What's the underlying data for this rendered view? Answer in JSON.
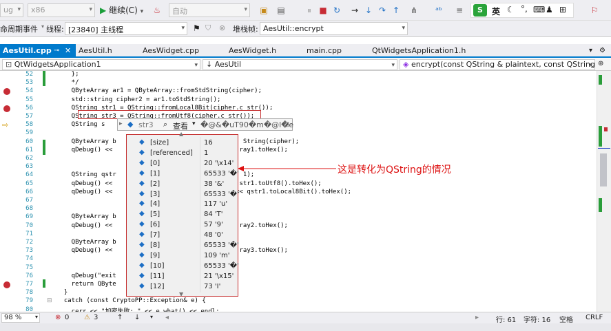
{
  "toolbar": {
    "config_partial": "ug",
    "platform": "x86",
    "continue_label": "继续(C)",
    "auto_label": "自动",
    "ime_letter": "S",
    "ime_lang": "英"
  },
  "toolbar2": {
    "lifecycle_label": "命周期事件",
    "thread_label": "线程:",
    "thread_value": "[23840] 主线程",
    "stack_label": "堆栈帧:",
    "stack_value": "AesUtil::encrypt"
  },
  "tabs": [
    {
      "label": "AesUtil.cpp"
    },
    {
      "label": "AesUtil.h"
    },
    {
      "label": "AesWidget.cpp"
    },
    {
      "label": "AesWidget.h"
    },
    {
      "label": "main.cpp"
    },
    {
      "label": "QtWidgetsApplication1.h"
    }
  ],
  "nav": {
    "project": "QtWidgetsApplication1",
    "scope": "↓ AesUtil",
    "member": "encrypt(const QString & plaintext, const QString"
  },
  "lines": [
    {
      "n": "52",
      "t": "    };"
    },
    {
      "n": "53",
      "t": "    */"
    },
    {
      "n": "54",
      "t": "    QByteArray ar1 = QByteArray::fromStdString(cipher);"
    },
    {
      "n": "55",
      "t": "    std::string cipher2 = ar1.toStdString();"
    },
    {
      "n": "56",
      "t": "    QString str1 = QString::fromLocal8Bit(cipher.c_str());"
    },
    {
      "n": "57",
      "t": "    QString str3 = QString::fromUtf8(cipher.c_str());"
    },
    {
      "n": "58",
      "t": "    QString s"
    },
    {
      "n": "59",
      "t": ""
    },
    {
      "n": "60",
      "t": "    QByteArray b                                  String(cipher);"
    },
    {
      "n": "61",
      "t": "    qDebug() <<                                  ray1.toHex();"
    },
    {
      "n": "62",
      "t": ""
    },
    {
      "n": "63",
      "t": ""
    },
    {
      "n": "64",
      "t": "    QString qstr                                  1);"
    },
    {
      "n": "65",
      "t": "    qDebug() <<                                  str1.toUtf8().toHex();"
    },
    {
      "n": "66",
      "t": "    qDebug() <<                                 << qstr1.toLocal8Bit().toHex();"
    },
    {
      "n": "67",
      "t": ""
    },
    {
      "n": "68",
      "t": ""
    },
    {
      "n": "69",
      "t": "    QByteArray b"
    },
    {
      "n": "70",
      "t": "    qDebug() <<                                  ray2.toHex();"
    },
    {
      "n": "71",
      "t": ""
    },
    {
      "n": "72",
      "t": "    QByteArray b"
    },
    {
      "n": "73",
      "t": "    qDebug() <<                                  ray3.toHex();"
    },
    {
      "n": "74",
      "t": ""
    },
    {
      "n": "75",
      "t": ""
    },
    {
      "n": "76",
      "t": "    qDebug(\"exit"
    },
    {
      "n": "77",
      "t": "    return QByte"
    },
    {
      "n": "78",
      "t": "  }"
    },
    {
      "n": "79",
      "t": "  catch (const CryptoPP::Exception& e) {"
    },
    {
      "n": "80",
      "t": "    cerr << \"加密失败: \" << e.what() << endl;"
    }
  ],
  "tipbar": {
    "var": "str3",
    "view_label": "查看",
    "garbled": "�@&�uT90�m�@l�e"
  },
  "popup_rows": [
    {
      "name": "[size]",
      "value": "16"
    },
    {
      "name": "[referenced]",
      "value": "1"
    },
    {
      "name": "[0]",
      "value": "20 '\\x14'"
    },
    {
      "name": "[1]",
      "value": "65533 '�'"
    },
    {
      "name": "[2]",
      "value": "38 '&'"
    },
    {
      "name": "[3]",
      "value": "65533 '�'"
    },
    {
      "name": "[4]",
      "value": "117 'u'"
    },
    {
      "name": "[5]",
      "value": "84 'T'"
    },
    {
      "name": "[6]",
      "value": "57 '9'"
    },
    {
      "name": "[7]",
      "value": "48 '0'"
    },
    {
      "name": "[8]",
      "value": "65533 '�'"
    },
    {
      "name": "[9]",
      "value": "109 'm'"
    },
    {
      "name": "[10]",
      "value": "65533 '�'"
    },
    {
      "name": "[11]",
      "value": "21 '\\x15'"
    },
    {
      "name": "[12]",
      "value": "73 'I'"
    }
  ],
  "annotation": "这是转化为QString的情况",
  "status": {
    "zoom": "98 %",
    "errors": "0",
    "warnings": "3",
    "line": "行: 61",
    "char": "字符: 16",
    "mode": "空格",
    "eol": "CRLF"
  },
  "colors": {
    "accent": "#007acc",
    "breakpoint": "#c72c35",
    "annotation": "#dd1111"
  }
}
